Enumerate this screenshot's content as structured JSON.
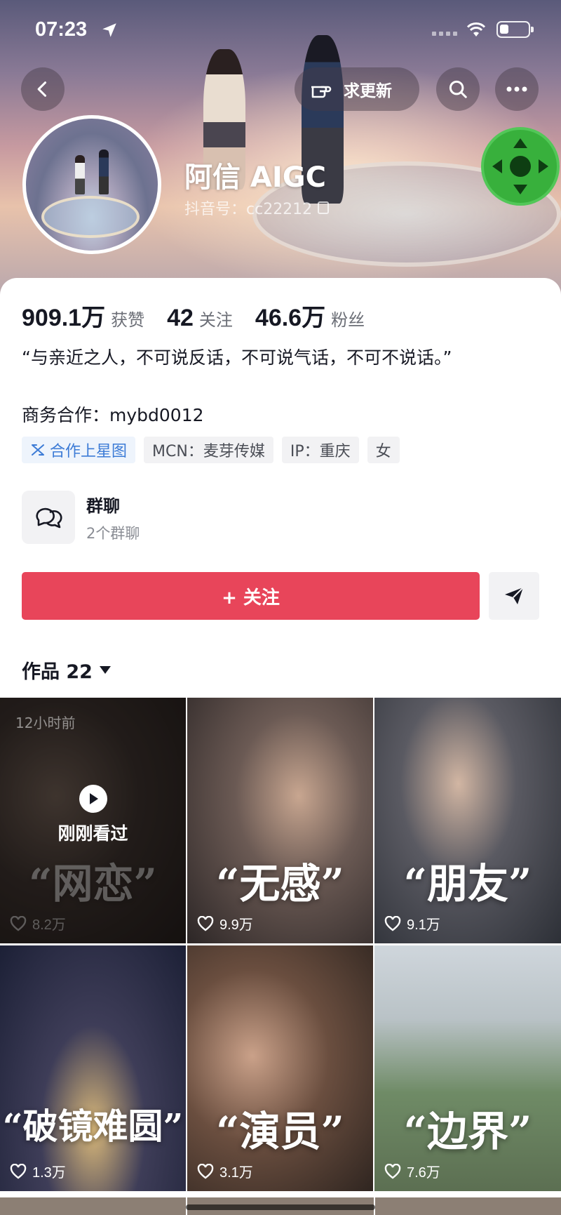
{
  "status_bar": {
    "time": "07:23"
  },
  "header": {
    "update_label": "求更新",
    "name": "阿信 AIGC",
    "douyin_id": "抖音号：cc22212"
  },
  "stats": [
    {
      "value": "909.1万",
      "label": "获赞"
    },
    {
      "value": "42",
      "label": "关注"
    },
    {
      "value": "46.6万",
      "label": "粉丝"
    }
  ],
  "bio": "“与亲近之人，不可说反话，不可说气话，不可不说话。”",
  "business": "商务合作：mybd0012",
  "tags": [
    {
      "label": "合作上星图",
      "icon": "star-map-icon",
      "style": "blue"
    },
    {
      "label": "MCN：麦芽传媒"
    },
    {
      "label": "IP：重庆"
    },
    {
      "label": "女"
    }
  ],
  "group_chat": {
    "title": "群聊",
    "subtitle": "2个群聊"
  },
  "follow_label": "+ 关注",
  "works_tab": "作品 22",
  "videos": [
    {
      "title": "“网恋”",
      "likes": "8.2万",
      "watched": true,
      "time_ago": "12小时前",
      "watched_label": "刚刚看过"
    },
    {
      "title": "“无感”",
      "likes": "9.9万"
    },
    {
      "title": "“朋友”",
      "likes": "9.1万"
    },
    {
      "title": "“破镜难圆”",
      "likes": "1.3万"
    },
    {
      "title": "“演员”",
      "likes": "3.1万"
    },
    {
      "title": "“边界”",
      "likes": "7.6万"
    }
  ],
  "colors": {
    "follow_red": "#e8455a",
    "tag_blue": "#3c7bd6",
    "joystick_green": "#38b03c"
  }
}
